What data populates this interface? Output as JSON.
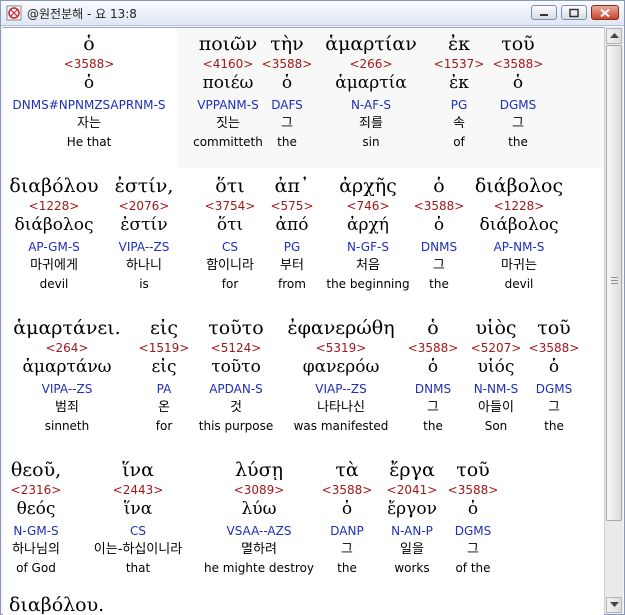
{
  "window": {
    "title": "@원전분해 - 요 13:8"
  },
  "rows": [
    [
      {
        "greek": "ὁ",
        "strong": "<3588>",
        "lemma": "ὁ",
        "parse": "DNMS#NPNMZSAPRNM-S",
        "korean": "자는",
        "english": "He that"
      },
      {
        "greek": "ποιῶν",
        "strong": "<4160>",
        "lemma": "ποιέω",
        "parse": "VPPANM-S",
        "korean": "짓는",
        "english": "committeth"
      },
      {
        "greek": "τὴν",
        "strong": "<3588>",
        "lemma": "ὁ",
        "parse": "DAFS",
        "korean": "그",
        "english": "the"
      },
      {
        "greek": "ἁμαρτίαν",
        "strong": "<266>",
        "lemma": "ἁμαρτία",
        "parse": "N-AF-S",
        "korean": "죄를",
        "english": "sin"
      },
      {
        "greek": "ἐκ",
        "strong": "<1537>",
        "lemma": "ἐκ",
        "parse": "PG",
        "korean": "속",
        "english": "of"
      },
      {
        "greek": "τοῦ",
        "strong": "<3588>",
        "lemma": "ὁ",
        "parse": "DGMS",
        "korean": "그",
        "english": "the"
      }
    ],
    [
      {
        "greek": "διαβόλου",
        "strong": "<1228>",
        "lemma": "διάβολος",
        "parse": "AP-GM-S",
        "korean": "마귀에게",
        "english": "devil"
      },
      {
        "greek": "ἐστίν,",
        "strong": "<2076>",
        "lemma": "ἐστίν",
        "parse": "VIPA--ZS",
        "korean": "하나니",
        "english": "is"
      },
      {
        "greek": "ὅτι",
        "strong": "<3754>",
        "lemma": "ὅτι",
        "parse": "CS",
        "korean": "함이니라",
        "english": "for"
      },
      {
        "greek": "ἀπ᾽",
        "strong": "<575>",
        "lemma": "ἀπό",
        "parse": "PG",
        "korean": "부터",
        "english": "from"
      },
      {
        "greek": "ἀρχῆς",
        "strong": "<746>",
        "lemma": "ἀρχή",
        "parse": "N-GF-S",
        "korean": "처음",
        "english": "the beginning"
      },
      {
        "greek": "ὁ",
        "strong": "<3588>",
        "lemma": "ὁ",
        "parse": "DNMS",
        "korean": "그",
        "english": "the"
      },
      {
        "greek": "διάβολος",
        "strong": "<1228>",
        "lemma": "διάβολος",
        "parse": "AP-NM-S",
        "korean": "마귀는",
        "english": "devil"
      }
    ],
    [
      {
        "greek": "ἁμαρτάνει.",
        "strong": "<264>",
        "lemma": "ἁμαρτάνω",
        "parse": "VIPA--ZS",
        "korean": "범죄",
        "english": "sinneth"
      },
      {
        "greek": "εἰς",
        "strong": "<1519>",
        "lemma": "εἰς",
        "parse": "PA",
        "korean": "온",
        "english": "for"
      },
      {
        "greek": "τοῦτο",
        "strong": "<5124>",
        "lemma": "τοῦτο",
        "parse": "APDAN-S",
        "korean": "것",
        "english": "this purpose"
      },
      {
        "greek": "ἐφανερώθη",
        "strong": "<5319>",
        "lemma": "φανερόω",
        "parse": "VIAP--ZS",
        "korean": "나타나신",
        "english": "was manifested"
      },
      {
        "greek": "ὁ",
        "strong": "<3588>",
        "lemma": "ὁ",
        "parse": "DNMS",
        "korean": "그",
        "english": "the"
      },
      {
        "greek": "υἱὸς",
        "strong": "<5207>",
        "lemma": "υἱός",
        "parse": "N-NM-S",
        "korean": "아들이",
        "english": "Son"
      },
      {
        "greek": "τοῦ",
        "strong": "<3588>",
        "lemma": "ὁ",
        "parse": "DGMS",
        "korean": "그",
        "english": "the"
      }
    ],
    [
      {
        "greek": "θεοῦ,",
        "strong": "<2316>",
        "lemma": "θεός",
        "parse": "N-GM-S",
        "korean": "하나님의",
        "english": "of God"
      },
      {
        "greek": "ἵνα",
        "strong": "<2443>",
        "lemma": "ἵνα",
        "parse": "CS",
        "korean": "이는-하십이니라",
        "english": "that"
      },
      {
        "greek": "λύσῃ",
        "strong": "<3089>",
        "lemma": "λύω",
        "parse": "VSAA--AZS",
        "korean": "멸하려",
        "english": "he mighte destroy"
      },
      {
        "greek": "τὰ",
        "strong": "<3588>",
        "lemma": "ὁ",
        "parse": "DANP",
        "korean": "그",
        "english": "the"
      },
      {
        "greek": "ἔργα",
        "strong": "<2041>",
        "lemma": "ἔργον",
        "parse": "N-AN-P",
        "korean": "일을",
        "english": "works"
      },
      {
        "greek": "τοῦ",
        "strong": "<3588>",
        "lemma": "ὁ",
        "parse": "DGMS",
        "korean": "그",
        "english": "of the"
      }
    ]
  ],
  "next_line_partial": "διαβόλου."
}
